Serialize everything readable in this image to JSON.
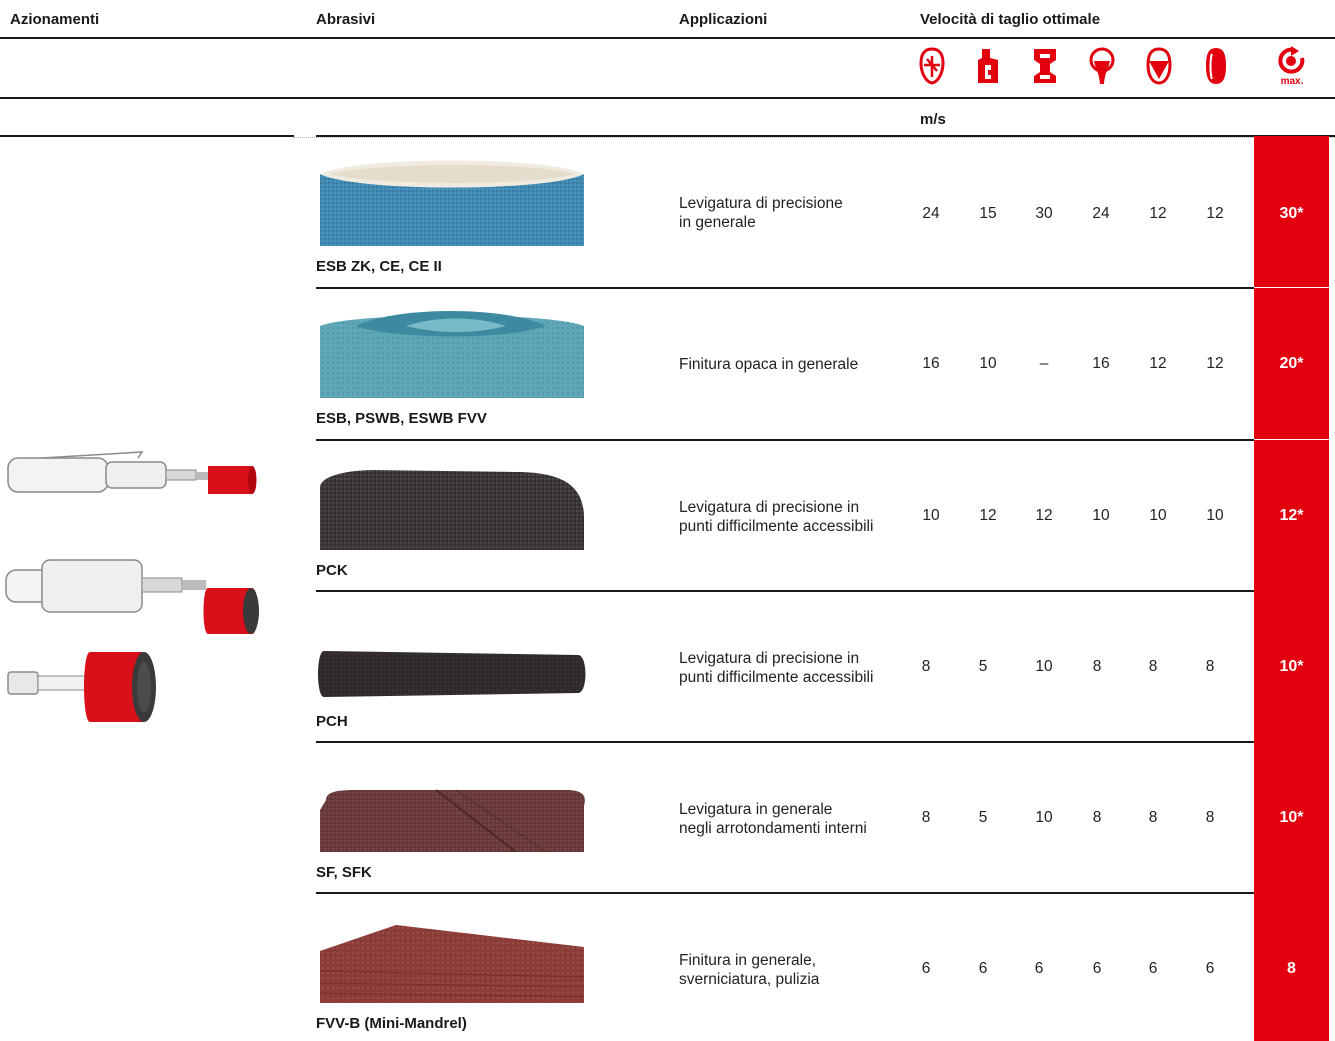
{
  "header": {
    "col_drives": "Azionamenti",
    "col_abrasives": "Abrasivi",
    "col_applications": "Applicazioni",
    "col_speed": "Velocità di taglio ottimale"
  },
  "material_icons": [
    "steel-icon",
    "stainless-steel-icon",
    "cast-iron-icon",
    "non-ferrous-icon",
    "aluminium-icon",
    "plastic-icon",
    "max-speed-icon"
  ],
  "max_icon_label": "max.",
  "unit": "m/s",
  "colors": {
    "accent_red": "#e2000f",
    "text": "#1a1a1a"
  },
  "rows": [
    {
      "product": "ESB ZK, CE, CE II",
      "image": "blue-zirconia-sanding-sleeve",
      "app_line1": "Levigatura di precisione",
      "app_line2": "in generale",
      "values": [
        "24",
        "15",
        "30",
        "24",
        "12",
        "12"
      ],
      "max": "30*"
    },
    {
      "product": "ESB, PSWB, ESWB FVV",
      "image": "blue-fleece-belt",
      "app_line1": "Finitura opaca in generale",
      "app_line2": "",
      "values": [
        "16",
        "10",
        "–",
        "16",
        "12",
        "12"
      ],
      "max": "20*"
    },
    {
      "product": "PCK",
      "image": "dark-cone-sleeve",
      "app_line1": "Levigatura di precisione in",
      "app_line2": "punti difficilmente accessibili",
      "values": [
        "10",
        "12",
        "12",
        "10",
        "10",
        "10"
      ],
      "max": "12*"
    },
    {
      "product": "PCH",
      "image": "dark-cylindrical-sleeve",
      "app_line1": "Levigatura di precisione in",
      "app_line2": "punti difficilmente accessibili",
      "values": [
        "8",
        "5",
        "10",
        "8",
        "8",
        "8"
      ],
      "max": "10*"
    },
    {
      "product": "SF, SFK",
      "image": "brown-spiral-band",
      "app_line1": "Levigatura in generale",
      "app_line2": "negli arrotondamenti interni",
      "values": [
        "8",
        "5",
        "10",
        "8",
        "8",
        "8"
      ],
      "max": "10*"
    },
    {
      "product": "FVV-B (Mini-Mandrel)",
      "image": "brown-fleece-stack",
      "app_line1": "Finitura in generale,",
      "app_line2": "sverniciatura, pulizia",
      "values": [
        "6",
        "6",
        "6",
        "6",
        "6",
        "6"
      ],
      "max": "8"
    }
  ]
}
